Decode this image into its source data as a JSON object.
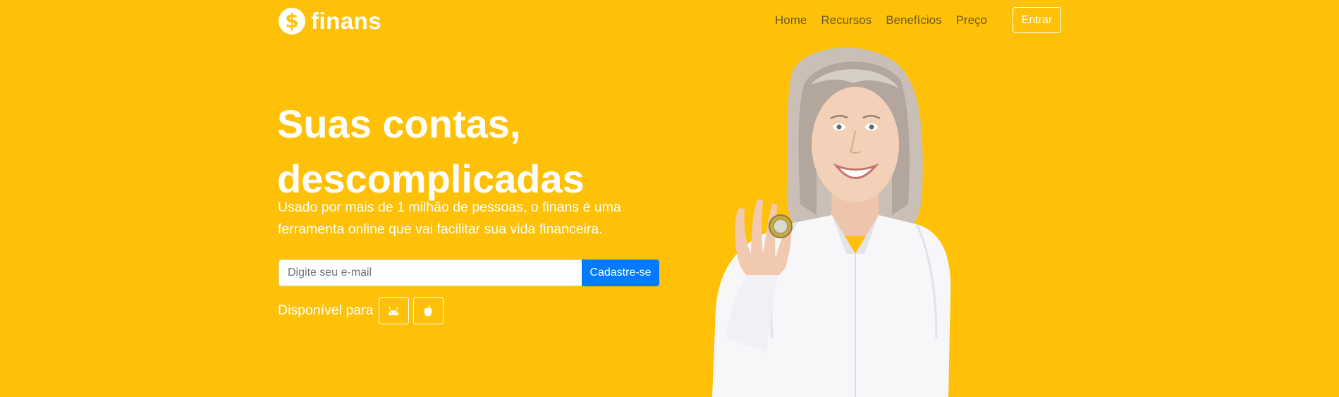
{
  "brand": {
    "name": "finans",
    "icon": "dollar-coin-icon"
  },
  "nav": {
    "links": [
      "Home",
      "Recursos",
      "Benefícios",
      "Preço"
    ],
    "login_label": "Entrar"
  },
  "hero": {
    "title_line1": "Suas contas,",
    "title_line2": "descomplicadas",
    "description": "Usado por mais de 1 milhão de pessoas, o finans é uma ferramenta online que vai facilitar sua vida financeira."
  },
  "signup": {
    "email_placeholder": "Digite seu e-mail",
    "button_label": "Cadastre-se"
  },
  "platforms": {
    "label": "Disponível para",
    "icons": [
      "android-icon",
      "apple-icon"
    ]
  },
  "colors": {
    "background": "#FFC107",
    "primary_button": "#007BFF",
    "text": "#FFFFFF"
  }
}
